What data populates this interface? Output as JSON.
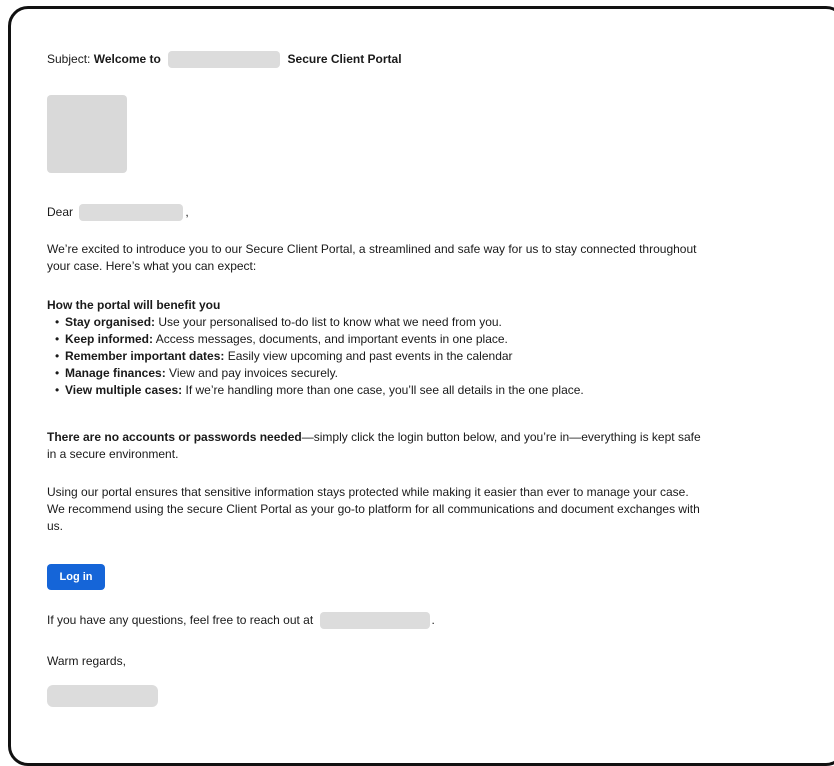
{
  "email": {
    "subject_label": "Subject:",
    "subject_part1": "Welcome to",
    "subject_part2": "Secure Client Portal",
    "greeting": "Dear",
    "greeting_punct": ",",
    "intro": "We’re excited to introduce you to our Secure Client Portal, a streamlined and safe way for us to stay connected throughout your case. Here’s what you can expect:",
    "benefits_heading": "How the portal will benefit you",
    "benefits": [
      {
        "title": "Stay organised:",
        "text": " Use your personalised to-do list to know what we need from you."
      },
      {
        "title": "Keep informed:",
        "text": " Access messages, documents, and important events in one place."
      },
      {
        "title": "Remember important dates:",
        "text": " Easily view upcoming and past events in the calendar"
      },
      {
        "title": "Manage finances:",
        "text": " View and pay invoices securely."
      },
      {
        "title": "View multiple cases:",
        "text": " If we’re handling more than one case, you’ll see all details in the one place."
      }
    ],
    "no_accounts_bold": "There are no accounts or passwords needed",
    "no_accounts_text": "—simply click the login button below, and you’re in—everything is kept safe in a secure environment.",
    "usage": "Using our portal ensures that sensitive information stays protected while making it easier than ever to manage your case. We recommend using the secure Client Portal as your go-to platform for all communications and document exchanges with us.",
    "login_label": "Log in",
    "questions": "If you have any questions, feel free to reach out at",
    "questions_punct": ".",
    "closing": "Warm regards,"
  },
  "colors": {
    "button": "#1565d8",
    "redaction": "#dcdcdc",
    "frame": "#111111"
  }
}
